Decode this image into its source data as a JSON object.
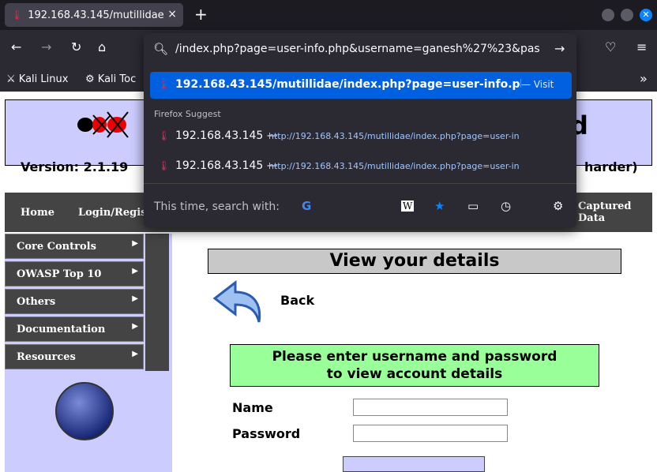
{
  "browser": {
    "tab_title": "192.168.43.145/mutillidae",
    "new_tab": "+",
    "tab_close": "×",
    "bookmarks": [
      "Kali Linux",
      "Kali Toc"
    ],
    "url": "/index.php?page=user-info.php&username=ganesh%27%23&pas",
    "overflow_chevron": "»"
  },
  "dropdown": {
    "active_suggestion": "192.168.43.145/mutillidae/index.php?page=user-info.php&",
    "visit_label": "— Visit",
    "section_label": "Firefox Suggest",
    "suggestions": [
      {
        "host": "192.168.43.145 —",
        "url": "http://192.168.43.145/mutillidae/index.php?page=user-in"
      },
      {
        "host": "192.168.43.145 —",
        "url": "http://192.168.43.145/mutillidae/index.php?page=user-in"
      }
    ],
    "search_with": "This time, search with:"
  },
  "page": {
    "version": "Version: 2.1.19",
    "harder": "harder)",
    "title_fragment": "d",
    "menu": {
      "home": "Home",
      "login": "Login/Regis",
      "captured_line1": "Captured",
      "captured_line2": "Data"
    },
    "sidebar": [
      "Core Controls",
      "OWASP Top 10",
      "Others",
      "Documentation",
      "Resources"
    ],
    "content_title": "View your details",
    "back": "Back",
    "note_line1": "Please enter username and password",
    "note_line2": "to view account details",
    "name_label": "Name",
    "password_label": "Password"
  },
  "colors": {
    "accent": "#0060df",
    "header_bg": "#ccccff",
    "note_bg": "#99ff99"
  }
}
